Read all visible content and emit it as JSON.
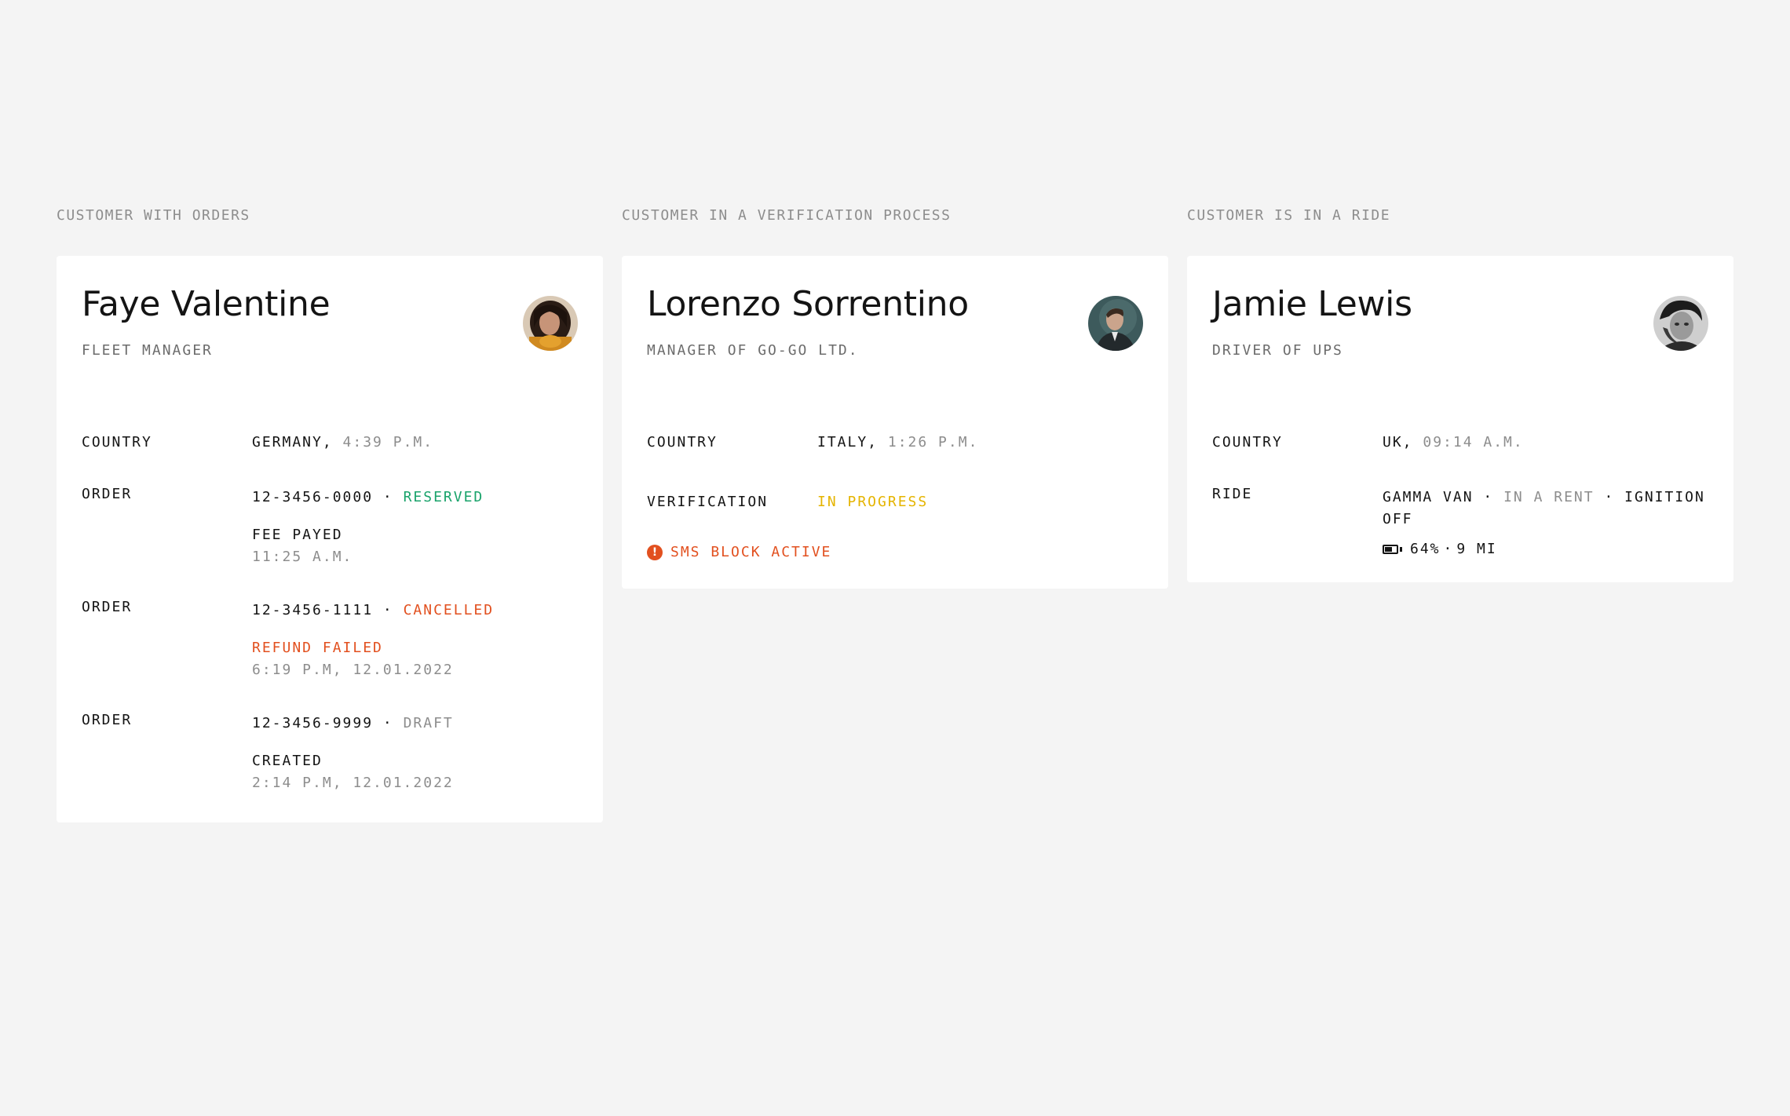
{
  "columns": [
    {
      "section_label": "CUSTOMER WITH ORDERS",
      "name": "Faye Valentine",
      "role": "FLEET MANAGER",
      "avatar": "avatar-woman",
      "country": {
        "label": "COUNTRY",
        "value": "GERMANY,",
        "time": "4:39 P.M."
      },
      "orders": [
        {
          "label": "ORDER",
          "number": "12-3456-0000",
          "sep": "·",
          "status": "RESERVED",
          "detail": "FEE PAYED",
          "time": "11:25 A.M."
        },
        {
          "label": "ORDER",
          "number": "12-3456-1111",
          "sep": "·",
          "status": "CANCELLED",
          "detail": "REFUND FAILED",
          "time": "6:19 P.M, 12.01.2022"
        },
        {
          "label": "ORDER",
          "number": "12-3456-9999",
          "sep": "·",
          "status": "DRAFT",
          "detail": "CREATED",
          "time": "2:14 P.M, 12.01.2022"
        }
      ]
    },
    {
      "section_label": "CUSTOMER IN A VERIFICATION PROCESS",
      "name": "Lorenzo Sorrentino",
      "role": "MANAGER OF GO-GO LTD.",
      "avatar": "avatar-man-suit",
      "country": {
        "label": "COUNTRY",
        "value": "ITALY,",
        "time": "1:26 P.M."
      },
      "verification": {
        "label": "VERIFICATION",
        "value": "IN PROGRESS"
      },
      "alert": {
        "icon": "!",
        "text": "SMS BLOCK ACTIVE"
      }
    },
    {
      "section_label": "CUSTOMER IS IN A RIDE",
      "name": "Jamie Lewis",
      "role": "DRIVER OF UPS",
      "avatar": "avatar-man-bw",
      "country": {
        "label": "COUNTRY",
        "value": "UK,",
        "time": "09:14 A.M."
      },
      "ride": {
        "label": "RIDE",
        "vehicle": "GAMMA VAN",
        "sep1": "·",
        "state": "IN A RENT",
        "sep2": "·",
        "ignition": "IGNITION OFF",
        "battery_percent": 64,
        "battery_text": "64%",
        "sep3": "·",
        "range": "9 MI"
      }
    }
  ],
  "colors": {
    "background": "#f4f4f4",
    "card": "#ffffff",
    "text": "#141414",
    "muted": "#8d8d8d",
    "green": "#1aa36b",
    "red": "#e2501f",
    "yellow": "#e5b400"
  }
}
